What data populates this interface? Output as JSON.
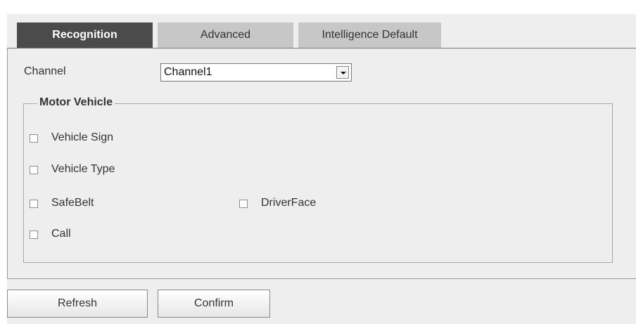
{
  "tabs": [
    {
      "label": "Recognition",
      "active": true
    },
    {
      "label": "Advanced",
      "active": false
    },
    {
      "label": "Intelligence Default",
      "active": false
    }
  ],
  "channel": {
    "label": "Channel",
    "selected": "Channel1"
  },
  "motor_vehicle": {
    "legend": "Motor Vehicle",
    "options": [
      {
        "label": "Vehicle Sign",
        "checked": false
      },
      {
        "label": "Vehicle Type",
        "checked": false
      },
      {
        "label": "SafeBelt",
        "checked": false
      },
      {
        "label": "DriverFace",
        "checked": false
      },
      {
        "label": "Call",
        "checked": false
      }
    ]
  },
  "buttons": {
    "refresh": "Refresh",
    "confirm": "Confirm"
  },
  "colors": {
    "active_tab": "#4b4b4b",
    "inactive_tab": "#c7c7c7",
    "panel_background": "#eeeeee"
  }
}
